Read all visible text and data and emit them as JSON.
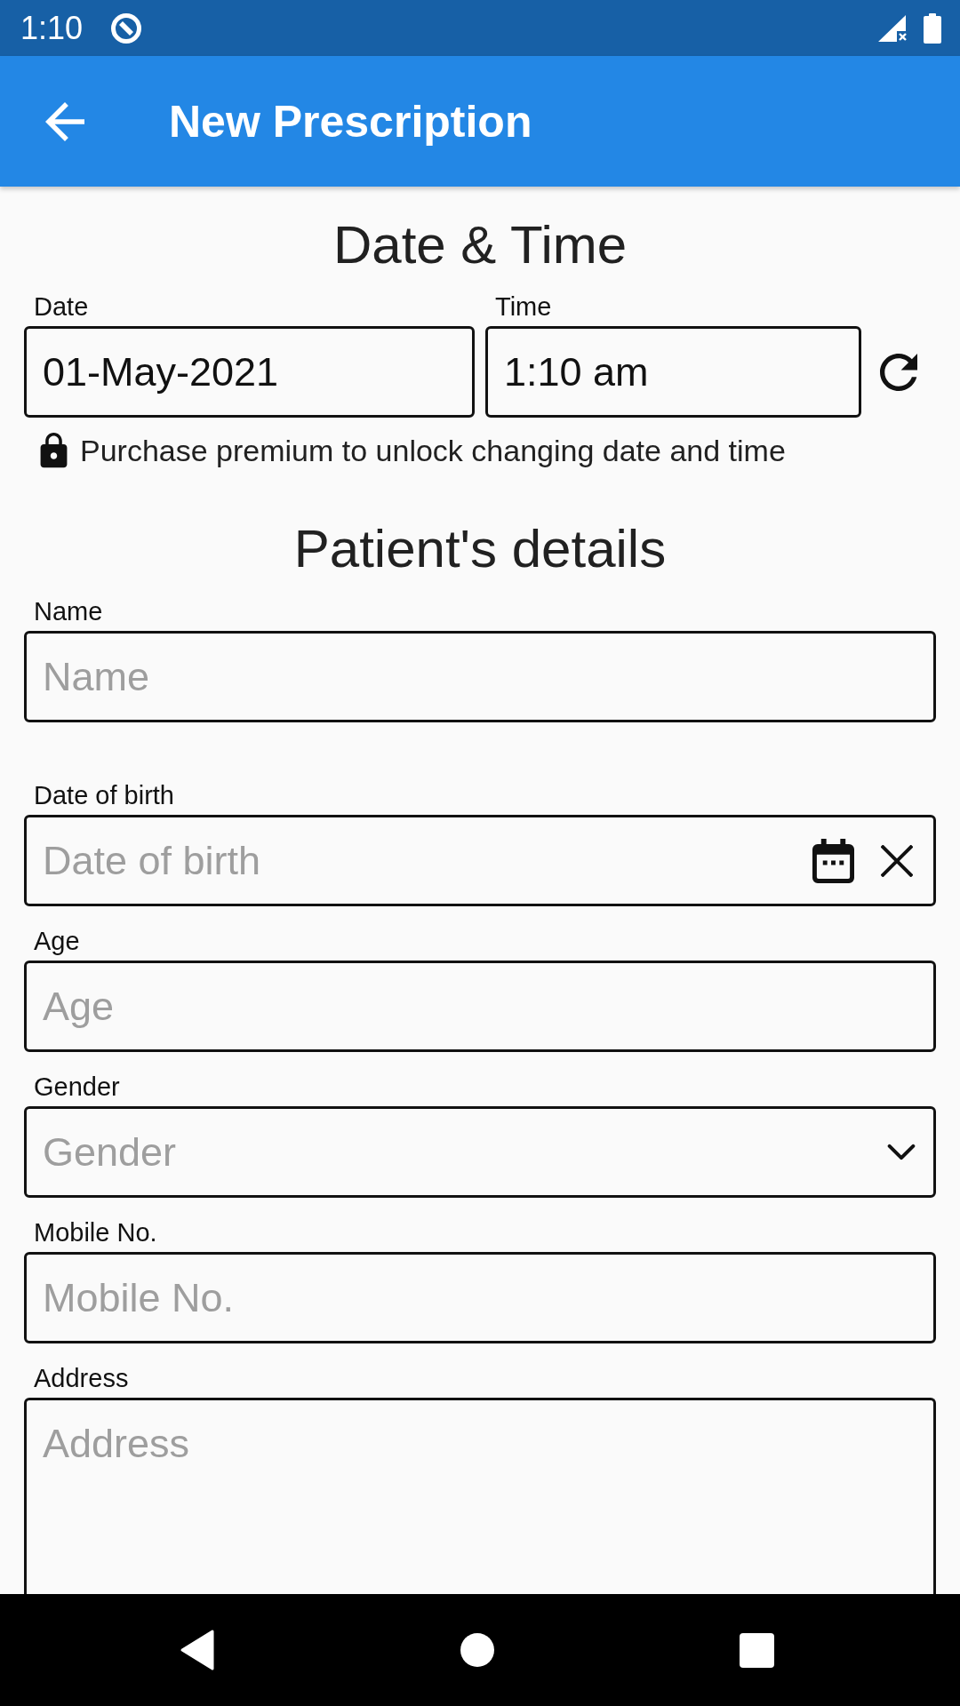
{
  "status_bar": {
    "time": "1:10"
  },
  "app_bar": {
    "title": "New Prescription"
  },
  "date_time": {
    "heading": "Date & Time",
    "fields": [
      {
        "label": "Date",
        "value": "01-May-2021"
      },
      {
        "label": "Time",
        "value": "1:10 am"
      }
    ],
    "notice": "Purchase premium to unlock changing date and time"
  },
  "patient": {
    "heading": "Patient's details",
    "fields": [
      {
        "kind": "text",
        "label": "Name",
        "placeholder": "Name"
      },
      {
        "kind": "date",
        "label": "Date of birth",
        "placeholder": "Date of birth"
      },
      {
        "kind": "text",
        "label": "Age",
        "placeholder": "Age"
      },
      {
        "kind": "dropdown",
        "label": "Gender",
        "placeholder": "Gender"
      },
      {
        "kind": "text",
        "label": "Mobile No.",
        "placeholder": "Mobile No."
      },
      {
        "kind": "multiline",
        "label": "Address",
        "placeholder": "Address"
      }
    ]
  }
}
